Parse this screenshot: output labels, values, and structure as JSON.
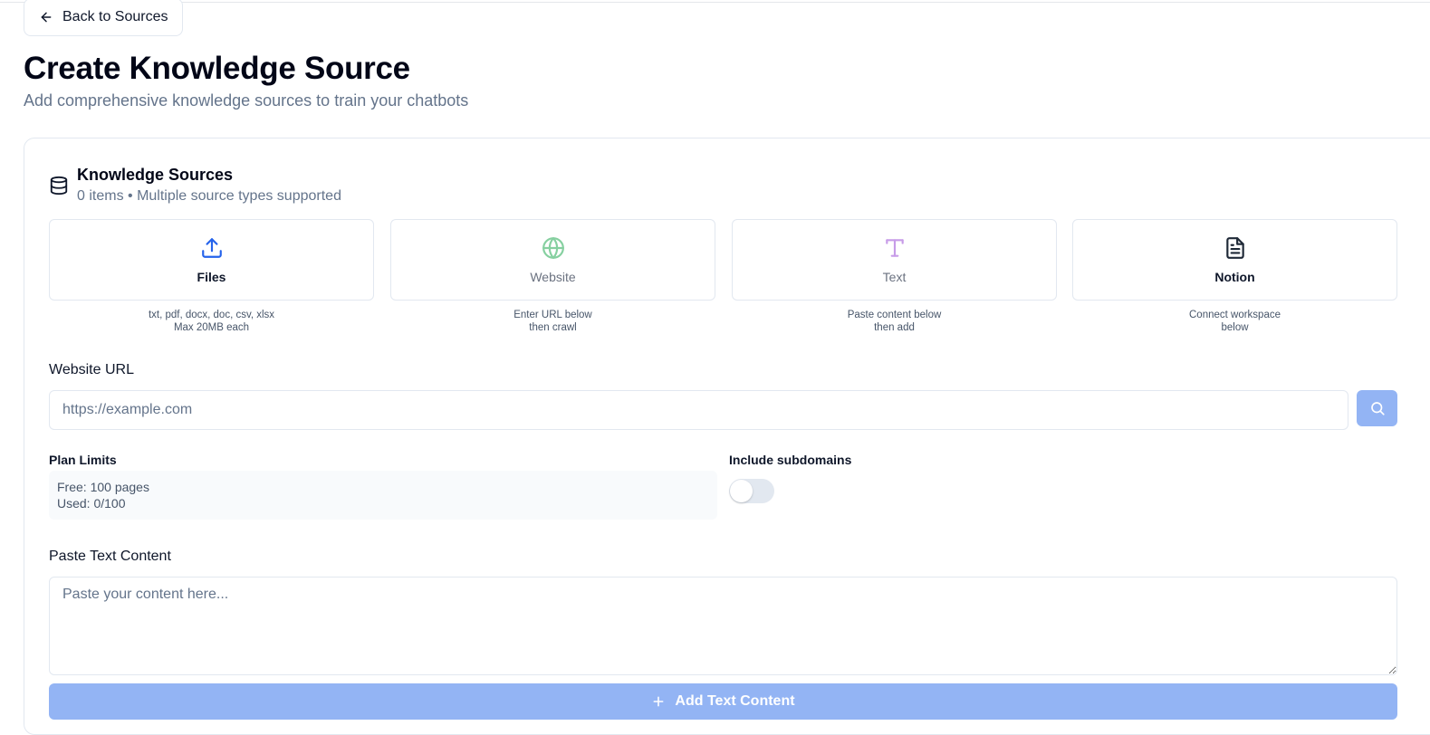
{
  "nav": {
    "back_label": "Back to Sources"
  },
  "header": {
    "title": "Create Knowledge Source",
    "subtitle": "Add comprehensive knowledge sources to train your chatbots"
  },
  "sources": {
    "title": "Knowledge Sources",
    "meta": "0 items • Multiple source types supported",
    "tiles": [
      {
        "label": "Files",
        "icon": "upload-icon",
        "color": "#2563eb",
        "label_color": "#0f172a",
        "note": [
          "txt, pdf, docx, doc, csv, xlsx",
          "Max 20MB each"
        ]
      },
      {
        "label": "Website",
        "icon": "globe-icon",
        "color": "#86d0a0",
        "label_color": "#6b7280",
        "note": [
          "Enter URL below",
          "then crawl"
        ]
      },
      {
        "label": "Text",
        "icon": "text-type-icon",
        "color": "#c79ce8",
        "label_color": "#6b7280",
        "note": [
          "Paste content below",
          "then add"
        ]
      },
      {
        "label": "Notion",
        "icon": "document-icon",
        "color": "#1f2937",
        "label_color": "#0f172a",
        "note": [
          "Connect workspace",
          "below"
        ]
      }
    ]
  },
  "website": {
    "label": "Website URL",
    "placeholder": "https://example.com"
  },
  "limits": {
    "label": "Plan Limits",
    "free": "Free: 100 pages",
    "used": "Used: 0/100"
  },
  "subdomains": {
    "label": "Include subdomains",
    "enabled": false
  },
  "paste": {
    "label": "Paste Text Content",
    "placeholder": "Paste your content here...",
    "button_label": "Add Text Content"
  },
  "colors": {
    "accent_disabled": "#93b4f4",
    "muted_text": "#64748b",
    "border": "#e2e8f0"
  }
}
